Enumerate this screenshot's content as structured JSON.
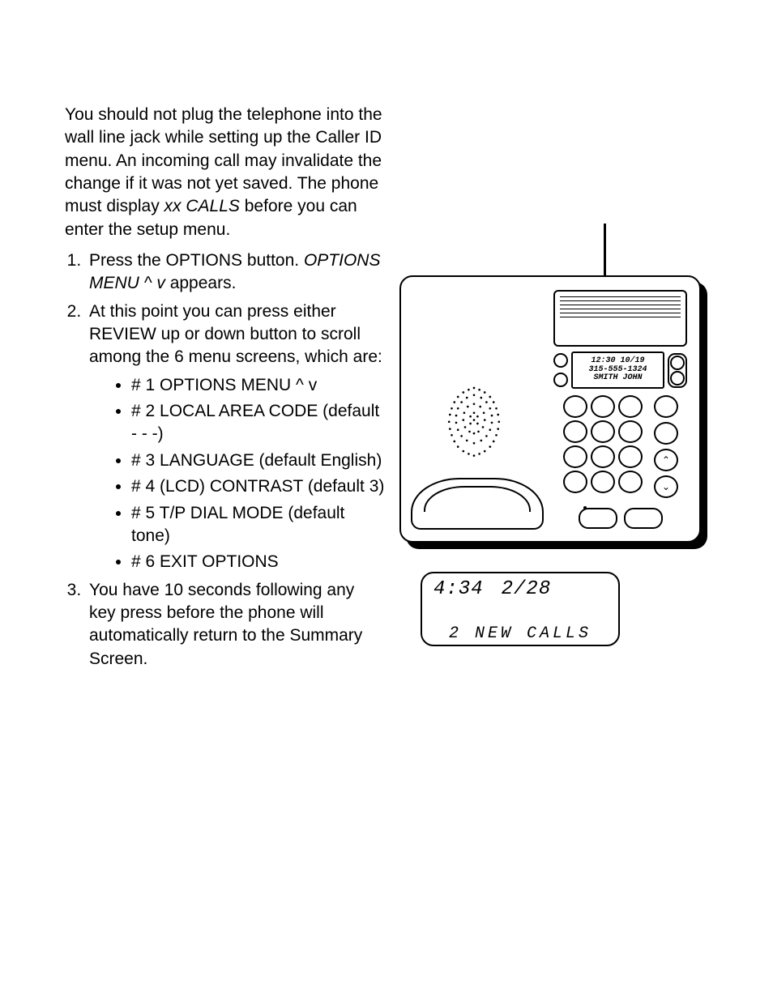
{
  "intro": {
    "pre": "You should not plug the telephone into the wall line jack while setting up the Caller ID menu. An incoming call may invalidate the change if it was not yet saved. The phone must display ",
    "italic": "xx CALLS",
    "post": " before you can enter the setup menu."
  },
  "steps": {
    "s1": {
      "pre": "Press the OPTIONS button. ",
      "italic": "OPTIONS MENU ^ v",
      "post": " appears."
    },
    "s2": {
      "text": "At this point you can press either REVIEW up or down button to scroll among the 6 menu screens, which are:",
      "items": [
        "# 1 OPTIONS MENU ^ v",
        "# 2  LOCAL AREA CODE (default - - -)",
        "# 3  LANGUAGE (default English)",
        "# 4  (LCD) CONTRAST (default 3)",
        "# 5  T/P DIAL MODE (default tone)",
        "# 6  EXIT OPTIONS"
      ]
    },
    "s3": "You have 10 seconds following any key press before the phone will automatically return to the Summary Screen."
  },
  "phone_lcd": {
    "line1": "12:30 10/19",
    "line2": "315-555-1324",
    "line3": "SMITH JOHN"
  },
  "mini_lcd": {
    "time": "4:34",
    "date": "2/28",
    "message": "2 NEW CALLS"
  }
}
